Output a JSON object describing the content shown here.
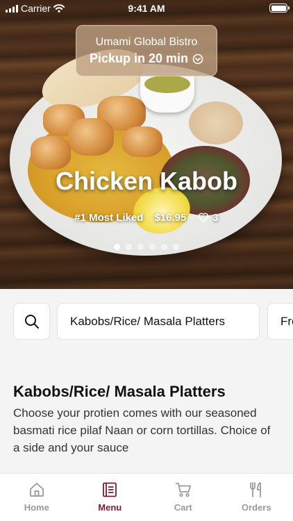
{
  "status_bar": {
    "carrier": "Carrier",
    "time": "9:41 AM"
  },
  "location": {
    "name": "Umami Global Bistro",
    "pickup": "Pickup in 20 min"
  },
  "featured": {
    "title": "Chicken Kabob",
    "badge": "#1 Most Liked",
    "price": "$16.95",
    "likes": "3",
    "slides_total": 6,
    "slide_active": 1
  },
  "categories": {
    "items": [
      "Kabobs/Rice/ Masala Platters",
      "Fre"
    ]
  },
  "section": {
    "title": "Kabobs/Rice/ Masala Platters",
    "description": "Choose your protien comes with our seasoned basmati rice pilaf Naan or corn tortillas. Choice of a side and your sauce"
  },
  "tabs": [
    {
      "label": "Home",
      "icon": "home-icon",
      "active": false
    },
    {
      "label": "Menu",
      "icon": "menu-icon",
      "active": true
    },
    {
      "label": "Cart",
      "icon": "cart-icon",
      "active": false
    },
    {
      "label": "Orders",
      "icon": "utensils-icon",
      "active": false
    }
  ],
  "colors": {
    "accent": "#7a1d2a",
    "inactive": "#9a9a9a"
  }
}
